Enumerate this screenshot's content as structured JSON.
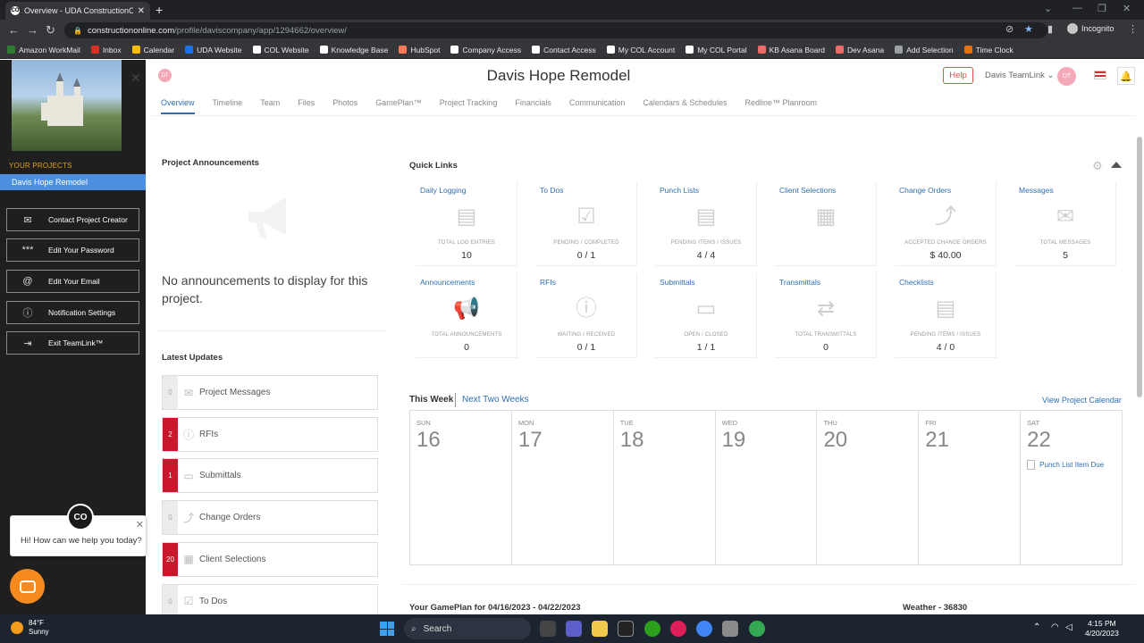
{
  "browser": {
    "tab_title": "Overview - UDA ConstructionOn",
    "favicon": "CO",
    "url_host": "constructiononline.com",
    "url_path": "/profile/daviscompany/app/1294662/overview/",
    "incognito_label": "Incognito",
    "bookmarks": [
      {
        "label": "Amazon WorkMail",
        "color": "#2e7d32"
      },
      {
        "label": "Inbox",
        "color": "#d93025"
      },
      {
        "label": "Calendar",
        "color": "#fbbc04"
      },
      {
        "label": "UDA Website",
        "color": "#1a73e8"
      },
      {
        "label": "COL Website",
        "color": "#ffffff"
      },
      {
        "label": "Knowledge Base",
        "color": "#ffffff"
      },
      {
        "label": "HubSpot",
        "color": "#ff7a59"
      },
      {
        "label": "Company Access",
        "color": "#ffffff"
      },
      {
        "label": "Contact Access",
        "color": "#ffffff"
      },
      {
        "label": "My COL Account",
        "color": "#ffffff"
      },
      {
        "label": "My COL Portal",
        "color": "#ffffff"
      },
      {
        "label": "KB Asana Board",
        "color": "#f06a6a"
      },
      {
        "label": "Dev Asana",
        "color": "#f06a6a"
      },
      {
        "label": "Add Selection",
        "color": "#9aa0a6"
      },
      {
        "label": "Time Clock",
        "color": "#e8710a"
      }
    ]
  },
  "left": {
    "projects_header": "YOUR PROJECTS",
    "selected_project": "Davis Hope Remodel",
    "buttons": [
      {
        "icon": "✉",
        "label": "Contact Project Creator"
      },
      {
        "icon": "***",
        "label": "Edit Your Password"
      },
      {
        "icon": "@",
        "label": "Edit Your Email"
      },
      {
        "icon": "ⓘ",
        "label": "Notification Settings"
      },
      {
        "icon": "⇥",
        "label": "Exit TeamLink™"
      }
    ],
    "chat_message": "Hi! How can we help you today?",
    "chat_avatar": "CO"
  },
  "header": {
    "avatar_initials": "DT",
    "title": "Davis Hope Remodel",
    "help": "Help",
    "teamlink": "Davis TeamLink",
    "tabs": [
      "Overview",
      "Timeline",
      "Team",
      "Files",
      "Photos",
      "GamePlan™",
      "Project Tracking",
      "Financials",
      "Communication",
      "Calendars & Schedules",
      "Redline™ Planroom"
    ]
  },
  "announcements": {
    "title": "Project Announcements",
    "empty_text": "No announcements to display for this project."
  },
  "latest_updates": {
    "title": "Latest Updates",
    "items": [
      {
        "count": "0",
        "label": "Project Messages",
        "icon": "✉",
        "status": "grey"
      },
      {
        "count": "2",
        "label": "RFIs",
        "icon": "ⓘ",
        "status": "red"
      },
      {
        "count": "1",
        "label": "Submittals",
        "icon": "▭",
        "status": "red"
      },
      {
        "count": "0",
        "label": "Change Orders",
        "icon": "⤴",
        "status": "grey"
      },
      {
        "count": "20",
        "label": "Client Selections",
        "icon": "▦",
        "status": "red"
      },
      {
        "count": "0",
        "label": "To Dos",
        "icon": "☑",
        "status": "grey"
      }
    ]
  },
  "quick_links": {
    "title": "Quick Links",
    "items": [
      {
        "name": "Daily Logging",
        "icon": "▤",
        "sub": "TOTAL LOG ENTRIES",
        "value": "10"
      },
      {
        "name": "To Dos",
        "icon": "☑",
        "sub": "PENDING / COMPLETED",
        "value": "0 / 1"
      },
      {
        "name": "Punch Lists",
        "icon": "▤",
        "sub": "PENDING ITEMS / ISSUES",
        "value": "4 / 4"
      },
      {
        "name": "Client Selections",
        "icon": "▦",
        "sub": "",
        "value": ""
      },
      {
        "name": "Change Orders",
        "icon": "⤴",
        "sub": "ACCEPTED CHANGE ORDERS",
        "value": "$ 40.00"
      },
      {
        "name": "Messages",
        "icon": "✉",
        "sub": "TOTAL MESSAGES",
        "value": "5"
      },
      {
        "name": "Announcements",
        "icon": "📢",
        "sub": "TOTAL ANNOUNCEMENTS",
        "value": "0"
      },
      {
        "name": "RFIs",
        "icon": "ⓘ",
        "sub": "WAITING / RECEIVED",
        "value": "0 / 1"
      },
      {
        "name": "Submittals",
        "icon": "▭",
        "sub": "OPEN / CLOSED",
        "value": "1 / 1"
      },
      {
        "name": "Transmittals",
        "icon": "⇄",
        "sub": "TOTAL TRANSMITTALS",
        "value": "0"
      },
      {
        "name": "Checklists",
        "icon": "▤",
        "sub": "PENDING ITEMS / ISSUES",
        "value": "4 / 0"
      }
    ]
  },
  "calendar": {
    "this_week": "This Week",
    "next_two_weeks": "Next Two Weeks",
    "view_link": "View Project Calendar",
    "days": [
      {
        "name": "SUN",
        "date": "16",
        "event": ""
      },
      {
        "name": "MON",
        "date": "17",
        "event": ""
      },
      {
        "name": "TUE",
        "date": "18",
        "event": ""
      },
      {
        "name": "WED",
        "date": "19",
        "event": ""
      },
      {
        "name": "THU",
        "date": "20",
        "event": ""
      },
      {
        "name": "FRI",
        "date": "21",
        "event": ""
      },
      {
        "name": "SAT",
        "date": "22",
        "event": "Punch List Item Due"
      }
    ]
  },
  "gameplan_title": "Your GamePlan for 04/16/2023 - 04/22/2023",
  "weather_title": "Weather - 36830",
  "taskbar": {
    "temp": "84°F",
    "condition": "Sunny",
    "search": "Search",
    "time": "4:15 PM",
    "date": "4/20/2023"
  },
  "colors": {
    "accent": "#2f6fb0",
    "badge_red": "#c9182b",
    "selected_blue": "#4d90e0"
  }
}
